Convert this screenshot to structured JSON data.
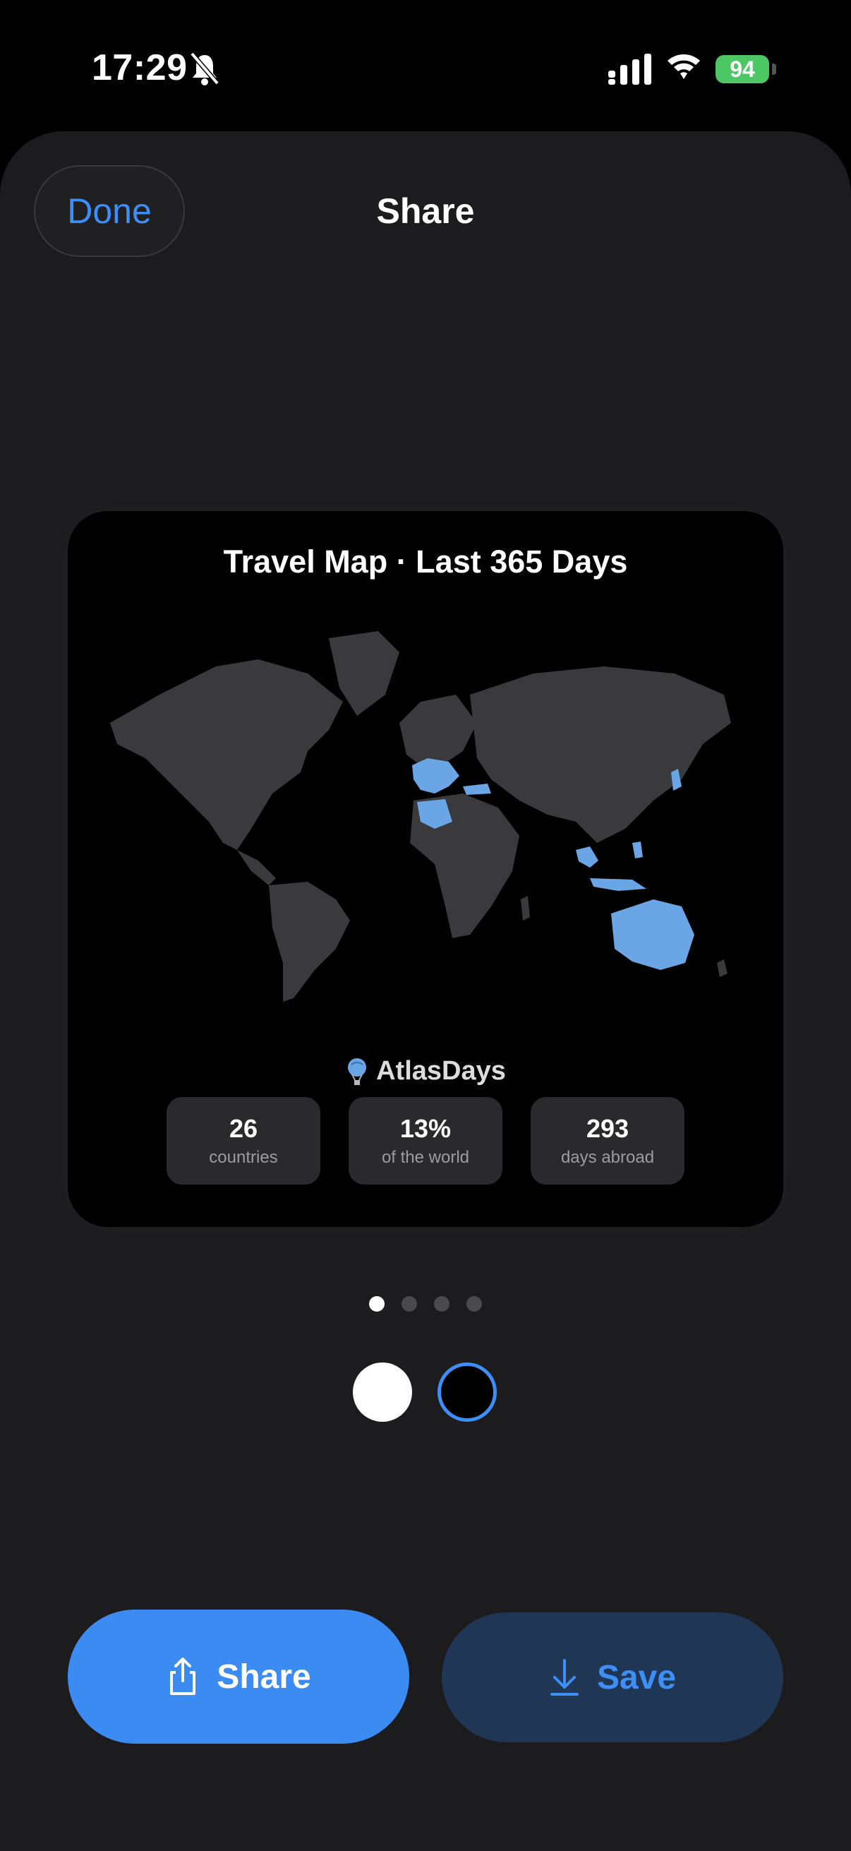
{
  "status_bar": {
    "time": "17:29",
    "battery": "94"
  },
  "header": {
    "done_label": "Done",
    "title": "Share"
  },
  "card": {
    "title": "Travel Map · Last 365 Days",
    "brand": "AtlasDays",
    "stats": [
      {
        "value": "26",
        "label": "countries"
      },
      {
        "value": "13%",
        "label": "of the world"
      },
      {
        "value": "293",
        "label": "days abroad"
      }
    ]
  },
  "pager": {
    "total": 4,
    "active": 1
  },
  "theme_options": [
    "white",
    "black"
  ],
  "selected_theme": "black",
  "actions": {
    "share_label": "Share",
    "save_label": "Save"
  },
  "colors": {
    "accent": "#3e8ef7",
    "visited": "#6aa6e6",
    "land": "#3a3a3c",
    "sheet": "#1c1c1e"
  }
}
